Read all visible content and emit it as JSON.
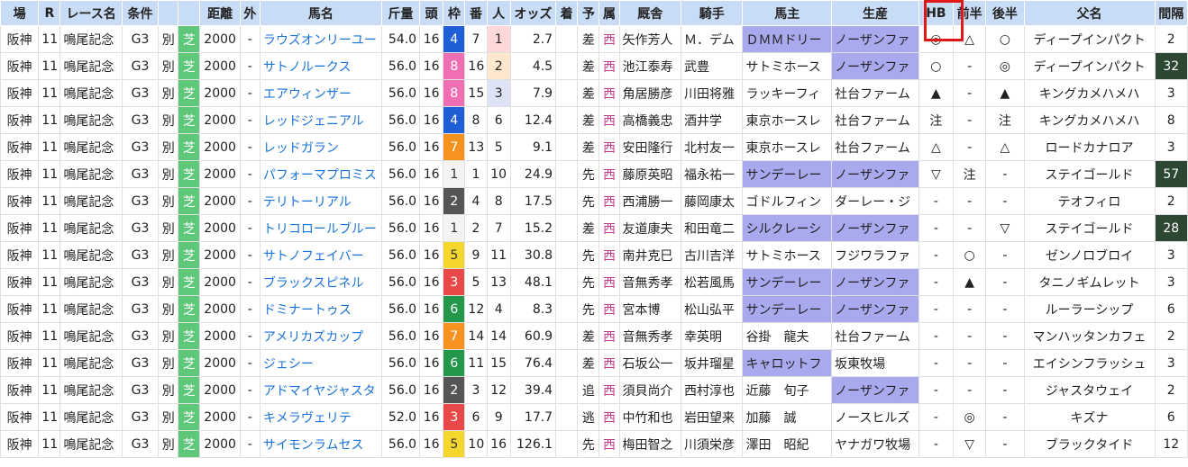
{
  "headers": [
    "場",
    "R",
    "レース名",
    "条件",
    "",
    "",
    "距離",
    "外",
    "馬名",
    "斤量",
    "頭",
    "枠",
    "番",
    "人",
    "オッズ",
    "着",
    "予",
    "属",
    "厩舎",
    "騎手",
    "馬主",
    "生産",
    "HB",
    "前半",
    "後半",
    "父名",
    "間隔"
  ],
  "rows": [
    [
      "阪神",
      "11",
      "鳴尾記念",
      "G3",
      "別",
      "芝",
      "2000",
      "-",
      "ラウズオンリーユー",
      "54.0",
      "16",
      "4",
      "7",
      "1",
      "2.7",
      "",
      "差",
      "西",
      "矢作芳人",
      "Ｍ．デム",
      "ＤＭＭドリー",
      "ノーザンファ",
      "◎",
      "△",
      "○",
      "ディープインパクト",
      "2"
    ],
    [
      "阪神",
      "11",
      "鳴尾記念",
      "G3",
      "別",
      "芝",
      "2000",
      "-",
      "サトノルークス",
      "56.0",
      "16",
      "8",
      "16",
      "2",
      "4.5",
      "",
      "差",
      "西",
      "池江泰寿",
      "武豊",
      "サトミホース",
      "ノーザンファ",
      "○",
      "-",
      "◎",
      "ディープインパクト",
      "32"
    ],
    [
      "阪神",
      "11",
      "鳴尾記念",
      "G3",
      "別",
      "芝",
      "2000",
      "-",
      "エアウィンザー",
      "56.0",
      "16",
      "8",
      "15",
      "3",
      "7.9",
      "",
      "差",
      "西",
      "角居勝彦",
      "川田将雅",
      "ラッキーフィ",
      "社台ファーム",
      "▲",
      "-",
      "▲",
      "キングカメハメハ",
      "3"
    ],
    [
      "阪神",
      "11",
      "鳴尾記念",
      "G3",
      "別",
      "芝",
      "2000",
      "-",
      "レッドジェニアル",
      "56.0",
      "16",
      "4",
      "8",
      "6",
      "12.4",
      "",
      "差",
      "西",
      "高橋義忠",
      "酒井学",
      "東京ホースレ",
      "社台ファーム",
      "注",
      "-",
      "注",
      "キングカメハメハ",
      "8"
    ],
    [
      "阪神",
      "11",
      "鳴尾記念",
      "G3",
      "別",
      "芝",
      "2000",
      "-",
      "レッドガラン",
      "56.0",
      "16",
      "7",
      "13",
      "5",
      "9.1",
      "",
      "差",
      "西",
      "安田隆行",
      "北村友一",
      "東京ホースレ",
      "社台ファーム",
      "△",
      "-",
      "△",
      "ロードカナロア",
      "3"
    ],
    [
      "阪神",
      "11",
      "鳴尾記念",
      "G3",
      "別",
      "芝",
      "2000",
      "-",
      "パフォーマプロミス",
      "56.0",
      "16",
      "1",
      "1",
      "10",
      "24.9",
      "",
      "先",
      "西",
      "藤原英昭",
      "福永祐一",
      "サンデーレー",
      "ノーザンファ",
      "▽",
      "注",
      "-",
      "ステイゴールド",
      "57"
    ],
    [
      "阪神",
      "11",
      "鳴尾記念",
      "G3",
      "別",
      "芝",
      "2000",
      "-",
      "テリトーリアル",
      "56.0",
      "16",
      "2",
      "4",
      "8",
      "17.5",
      "",
      "先",
      "西",
      "西浦勝一",
      "藤岡康太",
      "ゴドルフィン",
      "ダーレー・ジ",
      "-",
      "-",
      "-",
      "テオフィロ",
      "2"
    ],
    [
      "阪神",
      "11",
      "鳴尾記念",
      "G3",
      "別",
      "芝",
      "2000",
      "-",
      "トリコロールブルー",
      "56.0",
      "16",
      "1",
      "2",
      "7",
      "15.2",
      "",
      "差",
      "西",
      "友道康夫",
      "和田竜二",
      "シルクレーシ",
      "ノーザンファ",
      "-",
      "-",
      "▽",
      "ステイゴールド",
      "28"
    ],
    [
      "阪神",
      "11",
      "鳴尾記念",
      "G3",
      "別",
      "芝",
      "2000",
      "-",
      "サトノフェイバー",
      "56.0",
      "16",
      "5",
      "9",
      "11",
      "30.8",
      "",
      "先",
      "西",
      "南井克巳",
      "古川吉洋",
      "サトミホース",
      "フジワラファ",
      "-",
      "○",
      "-",
      "ゼンノロブロイ",
      "3"
    ],
    [
      "阪神",
      "11",
      "鳴尾記念",
      "G3",
      "別",
      "芝",
      "2000",
      "-",
      "ブラックスピネル",
      "56.0",
      "16",
      "3",
      "5",
      "13",
      "48.1",
      "",
      "先",
      "西",
      "音無秀孝",
      "松若風馬",
      "サンデーレー",
      "ノーザンファ",
      "-",
      "▲",
      "-",
      "タニノギムレット",
      "3"
    ],
    [
      "阪神",
      "11",
      "鳴尾記念",
      "G3",
      "別",
      "芝",
      "2000",
      "-",
      "ドミナートゥス",
      "56.0",
      "16",
      "6",
      "12",
      "4",
      "8.3",
      "",
      "先",
      "西",
      "宮本博",
      "松山弘平",
      "サンデーレー",
      "ノーザンファ",
      "-",
      "-",
      "-",
      "ルーラーシップ",
      "6"
    ],
    [
      "阪神",
      "11",
      "鳴尾記念",
      "G3",
      "別",
      "芝",
      "2000",
      "-",
      "アメリカズカップ",
      "56.0",
      "16",
      "7",
      "14",
      "14",
      "60.9",
      "",
      "差",
      "西",
      "音無秀孝",
      "幸英明",
      "谷掛　龍夫",
      "社台ファーム",
      "-",
      "-",
      "-",
      "マンハッタンカフェ",
      "2"
    ],
    [
      "阪神",
      "11",
      "鳴尾記念",
      "G3",
      "別",
      "芝",
      "2000",
      "-",
      "ジェシー",
      "56.0",
      "16",
      "6",
      "11",
      "15",
      "76.4",
      "",
      "差",
      "西",
      "石坂公一",
      "坂井瑠星",
      "キャロットフ",
      "坂東牧場",
      "-",
      "-",
      "-",
      "エイシンフラッシュ",
      "3"
    ],
    [
      "阪神",
      "11",
      "鳴尾記念",
      "G3",
      "別",
      "芝",
      "2000",
      "-",
      "アドマイヤジャスタ",
      "56.0",
      "16",
      "2",
      "3",
      "12",
      "39.4",
      "",
      "追",
      "西",
      "須貝尚介",
      "西村淳也",
      "近藤　旬子",
      "ノーザンファ",
      "-",
      "-",
      "-",
      "ジャスタウェイ",
      "2"
    ],
    [
      "阪神",
      "11",
      "鳴尾記念",
      "G3",
      "別",
      "芝",
      "2000",
      "-",
      "キメラヴェリテ",
      "52.0",
      "16",
      "3",
      "6",
      "9",
      "17.7",
      "",
      "逃",
      "西",
      "中竹和也",
      "岩田望来",
      "加藤　誠",
      "ノースヒルズ",
      "-",
      "◎",
      "-",
      "キズナ",
      "6"
    ],
    [
      "阪神",
      "11",
      "鳴尾記念",
      "G3",
      "別",
      "芝",
      "2000",
      "-",
      "サイモンラムセス",
      "56.0",
      "16",
      "5",
      "10",
      "16",
      "126.1",
      "",
      "先",
      "西",
      "梅田智之",
      "川須栄彦",
      "澤田　昭紀",
      "ヤナガワ牧場",
      "-",
      "▽",
      "-",
      "ブラックタイド",
      "12"
    ]
  ],
  "highlight_owner": [
    "ＤＭＭドリー",
    "サンデーレー",
    "シルクレーシ",
    "キャロットフ"
  ],
  "highlight_breeder": [
    "ノーザンファ"
  ],
  "dark_interval_threshold": 25
}
